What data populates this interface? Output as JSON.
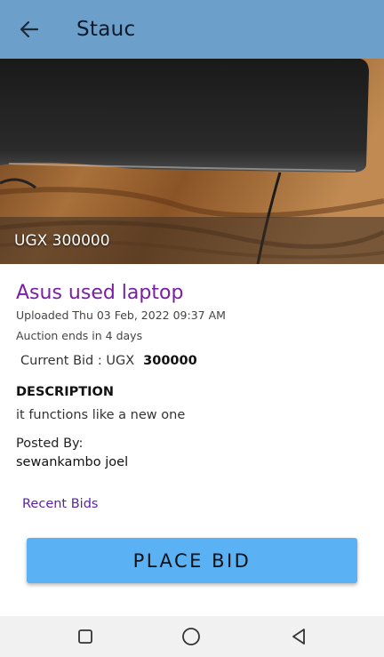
{
  "appbar": {
    "title": "Stauc",
    "back_icon": "arrow-left-icon"
  },
  "listing": {
    "price_overlay": "UGX 300000",
    "title": "Asus used laptop",
    "uploaded": "Uploaded Thu 03 Feb, 2022 09:37 AM",
    "auction_ends": "Auction ends in 4 days",
    "current_bid_label": "Current Bid : UGX",
    "current_bid_value": "300000",
    "description_heading": "DESCRIPTION",
    "description": "it functions like a new one",
    "posted_by_label": "Posted By:",
    "posted_by_name": "sewankambo joel",
    "recent_bids_link": "Recent Bids",
    "place_bid_label": "PLACE BID"
  },
  "colors": {
    "appbar": "#6d9fcb",
    "title_purple": "#7a1ea8",
    "link_purple": "#5a1fa8",
    "button_blue": "#5ab1f4"
  },
  "system_nav": {
    "recents_icon": "square-icon",
    "home_icon": "circle-icon",
    "back_icon": "triangle-back-icon"
  }
}
